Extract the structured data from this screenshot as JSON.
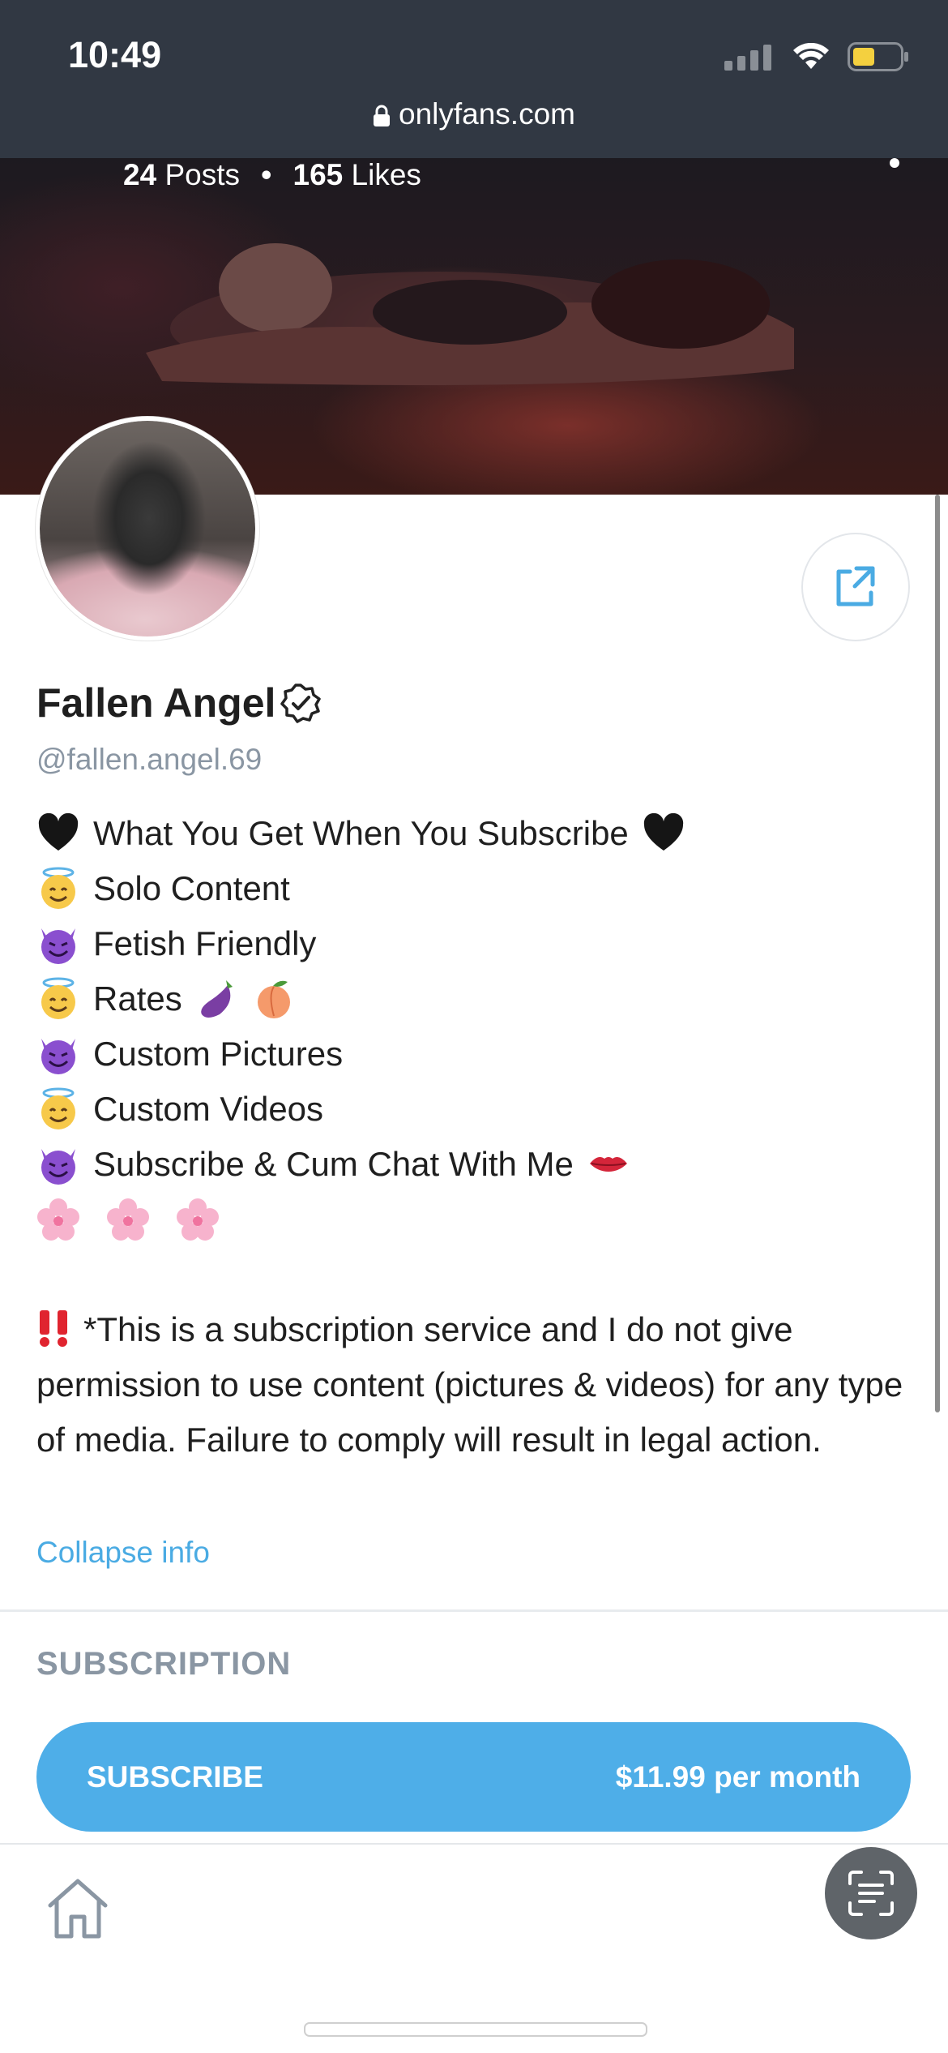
{
  "status_bar": {
    "time": "10:49"
  },
  "browser": {
    "url": "onlyfans.com"
  },
  "profile": {
    "posts": "24",
    "posts_label": "Posts",
    "likes": "165",
    "likes_label": "Likes",
    "name": "Fallen Angel",
    "handle": "@fallen.angel.69",
    "bio_lines": [
      {
        "text": "What You Get When You Subscribe"
      },
      {
        "text": "Solo Content"
      },
      {
        "text": "Fetish Friendly"
      },
      {
        "text": "Rates"
      },
      {
        "text": "Custom Pictures"
      },
      {
        "text": "Custom Videos"
      },
      {
        "text": "Subscribe & Cum Chat With Me"
      }
    ],
    "disclaimer": "*This is a subscription service and I do not give permission to use content (pictures & videos) for any type of media. Failure to comply will result in legal action.",
    "collapse_label": "Collapse info"
  },
  "subscription": {
    "section_label": "SUBSCRIPTION",
    "button_label": "SUBSCRIBE",
    "price": "$11.99 per month"
  },
  "icons": {
    "black_heart": "black-heart-icon",
    "angel": "smiling-face-with-halo-icon",
    "devil": "smiling-face-with-horns-icon",
    "eggplant": "eggplant-icon",
    "peach": "peach-icon",
    "lips": "kiss-mark-icon",
    "flower": "cherry-blossom-icon",
    "bang": "double-exclamation-icon"
  },
  "colors": {
    "accent": "#4eaee8",
    "muted": "#8a96a3",
    "topbar": "#313843"
  }
}
